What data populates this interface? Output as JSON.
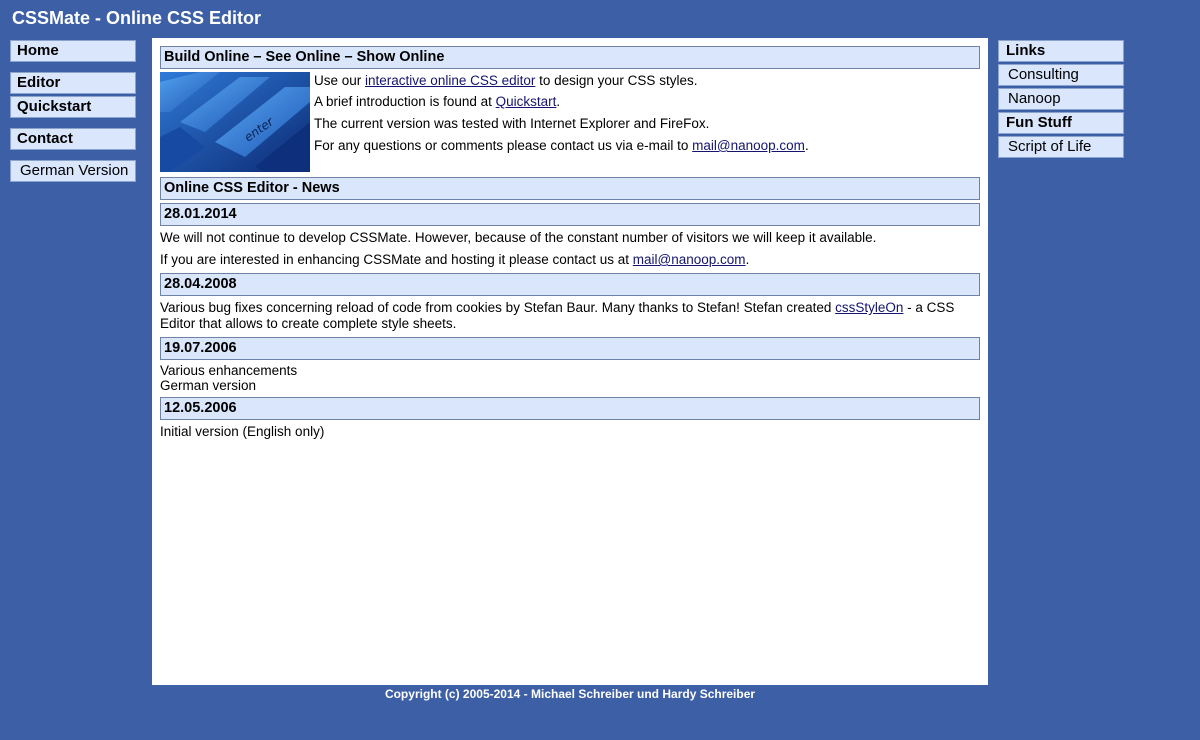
{
  "site": {
    "title": "CSSMate - Online CSS Editor"
  },
  "left_nav": {
    "home": "Home",
    "editor": "Editor",
    "quickstart": "Quickstart",
    "contact": "Contact",
    "german": "German Version"
  },
  "right_nav": {
    "links_heading": "Links",
    "consulting": "Consulting",
    "nanoop": "Nanoop",
    "fun_heading": "Fun Stuff",
    "script_of_life": "Script of Life"
  },
  "intro": {
    "heading": "Build Online – See Online – Show Online",
    "image_icon": "enter-key-keyboard-image",
    "key_label": "enter",
    "l1_pre": "Use our ",
    "l1_link": "interactive online CSS editor",
    "l1_post": " to design your CSS styles.",
    "l2_pre": "A brief introduction is found at ",
    "l2_link": "Quickstart",
    "l2_post": ".",
    "l3": "The current version was tested with Internet Explorer and FireFox.",
    "l4_pre": "For any questions or comments please contact us via e-mail to ",
    "l4_link": "mail@nanoop.com",
    "l4_post": "."
  },
  "news": {
    "heading": "Online CSS Editor - News",
    "e1_date": "28.01.2014",
    "e1_l1": "We will not continue to develop CSSMate. However, because of the constant number of visitors we will keep it available.",
    "e1_l2_pre": "If you are interested in enhancing CSSMate and hosting it please contact us at ",
    "e1_l2_link": "mail@nanoop.com",
    "e1_l2_post": ".",
    "e2_date": "28.04.2008",
    "e2_pre": "Various bug fixes concerning reload of code from cookies by Stefan Baur. Many thanks to Stefan! Stefan created ",
    "e2_link": "cssStyleOn",
    "e2_post": " - a CSS Editor that allows to create complete style sheets.",
    "e3_date": "19.07.2006",
    "e3_l1": "Various enhancements",
    "e3_l2": "German version",
    "e4_date": "12.05.2006",
    "e4_l1": "Initial version (English only)"
  },
  "footer": {
    "copyright": "Copyright (c) 2005-2014 -  Michael Schreiber  und Hardy Schreiber"
  },
  "colors": {
    "page_bg": "#3d5fa6",
    "box_bg": "#d9e6fb",
    "link": "#141470"
  }
}
